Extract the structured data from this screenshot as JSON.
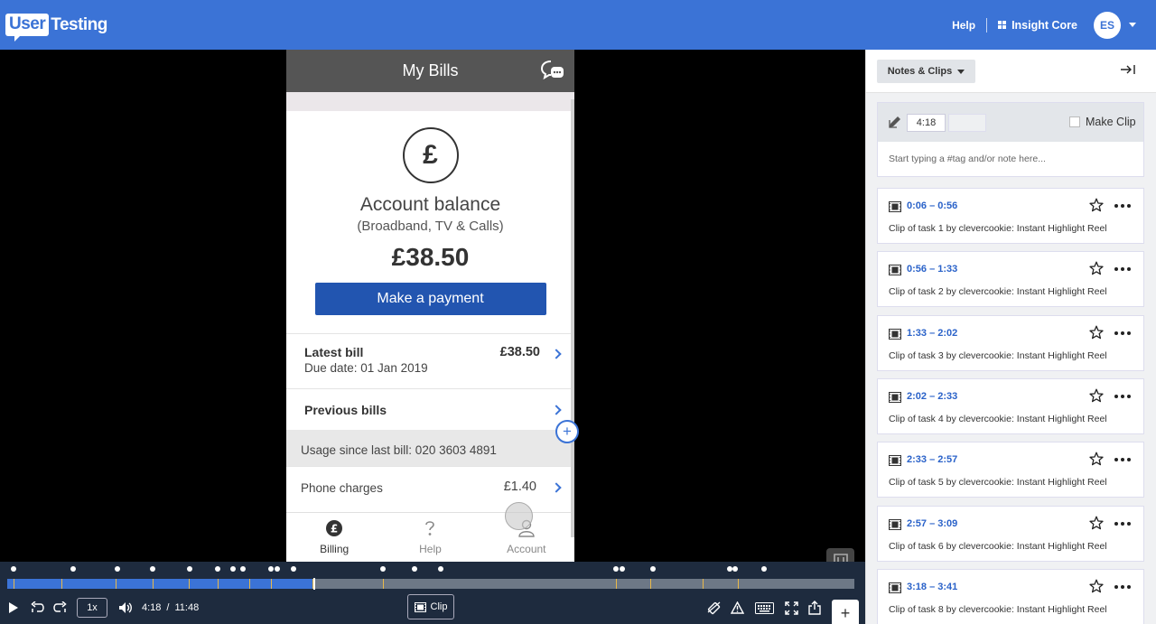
{
  "header": {
    "logo_user": "User",
    "logo_testing": "Testing",
    "help": "Help",
    "workspace": "Insight Core",
    "avatar": "ES"
  },
  "phone": {
    "title": "My Bills",
    "currency_symbol": "£",
    "account_title": "Account balance",
    "account_sub": "(Broadband, TV & Calls)",
    "balance": "£38.50",
    "pay_button": "Make a payment",
    "latest_bill_label": "Latest bill",
    "latest_bill_due": "Due date: 01 Jan 2019",
    "latest_bill_amount": "£38.50",
    "previous_bills": "Previous bills",
    "usage": "Usage since last bill: 020 3603 4891",
    "phone_charges_label": "Phone charges",
    "phone_charges_amount": "£1.40",
    "tabs": [
      {
        "label": "Billing"
      },
      {
        "label": "Help"
      },
      {
        "label": "Account"
      }
    ]
  },
  "player": {
    "speed": "1x",
    "current_time": "4:18",
    "time_sep": "/",
    "duration": "11:48",
    "clip_label": "Clip",
    "played_fraction": 0.363
  },
  "panel": {
    "dropdown": "Notes & Clips",
    "note_time": "4:18",
    "make_clip": "Make Clip",
    "note_placeholder": "Start typing a #tag and/or note here...",
    "clips": [
      {
        "range": "0:06 – 0:56",
        "desc": "Clip of task 1 by clevercookie: Instant Highlight Reel"
      },
      {
        "range": "0:56 – 1:33",
        "desc": "Clip of task 2 by clevercookie: Instant Highlight Reel"
      },
      {
        "range": "1:33 – 2:02",
        "desc": "Clip of task 3 by clevercookie: Instant Highlight Reel"
      },
      {
        "range": "2:02 – 2:33",
        "desc": "Clip of task 4 by clevercookie: Instant Highlight Reel"
      },
      {
        "range": "2:33 – 2:57",
        "desc": "Clip of task 5 by clevercookie: Instant Highlight Reel"
      },
      {
        "range": "2:57 – 3:09",
        "desc": "Clip of task 6 by clevercookie: Instant Highlight Reel"
      },
      {
        "range": "3:18 – 3:41",
        "desc": "Clip of task 8 by clevercookie: Instant Highlight Reel"
      }
    ]
  }
}
